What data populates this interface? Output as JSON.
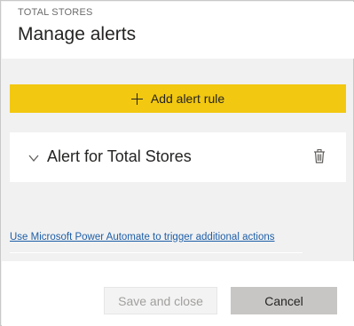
{
  "header": {
    "eyebrow": "TOTAL STORES",
    "title": "Manage alerts"
  },
  "add_rule": {
    "label": "Add alert rule",
    "icon": "plus-icon",
    "color": "#f2c811"
  },
  "alerts": [
    {
      "label": "Alert for Total Stores",
      "expand_icon": "chevron-down-icon",
      "delete_icon": "trash-icon"
    }
  ],
  "automate_link": "Use Microsoft Power Automate to trigger additional actions",
  "footer": {
    "save_label": "Save and close",
    "cancel_label": "Cancel"
  }
}
